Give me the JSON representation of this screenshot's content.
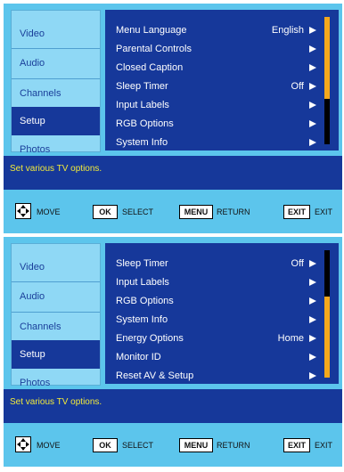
{
  "colors": {
    "panel_bg": "#5cc5ec",
    "menu_bg": "#16389a",
    "sidebar_bg": "#8fd8f5",
    "help_text": "#f2ea3a",
    "scroll_thumb": "#f4a81c"
  },
  "screens": [
    {
      "sidebar": [
        "Video",
        "Audio",
        "Channels",
        "Setup",
        "Photos"
      ],
      "active_tab": "Setup",
      "menu": [
        {
          "label": "Menu Language",
          "value": "English"
        },
        {
          "label": "Parental Controls",
          "value": ""
        },
        {
          "label": "Closed Caption",
          "value": ""
        },
        {
          "label": "Sleep Timer",
          "value": "Off"
        },
        {
          "label": "Input Labels",
          "value": ""
        },
        {
          "label": "RGB Options",
          "value": ""
        },
        {
          "label": "System Info",
          "value": ""
        }
      ],
      "help_text": "Set various TV options.",
      "footer": {
        "move": "MOVE",
        "ok_key": "OK",
        "select": "SELECT",
        "menu_key": "MENU",
        "return": "RETURN",
        "exit_key": "EXIT",
        "exit": "EXIT"
      }
    },
    {
      "sidebar": [
        "Video",
        "Audio",
        "Channels",
        "Setup",
        "Photos"
      ],
      "active_tab": "Setup",
      "menu": [
        {
          "label": "Sleep Timer",
          "value": "Off"
        },
        {
          "label": "Input Labels",
          "value": ""
        },
        {
          "label": "RGB Options",
          "value": ""
        },
        {
          "label": "System Info",
          "value": ""
        },
        {
          "label": "Energy Options",
          "value": "Home"
        },
        {
          "label": "Monitor ID",
          "value": ""
        },
        {
          "label": "Reset AV & Setup",
          "value": ""
        }
      ],
      "help_text": "Set various TV options.",
      "footer": {
        "move": "MOVE",
        "ok_key": "OK",
        "select": "SELECT",
        "menu_key": "MENU",
        "return": "RETURN",
        "exit_key": "EXIT",
        "exit": "EXIT"
      }
    }
  ]
}
